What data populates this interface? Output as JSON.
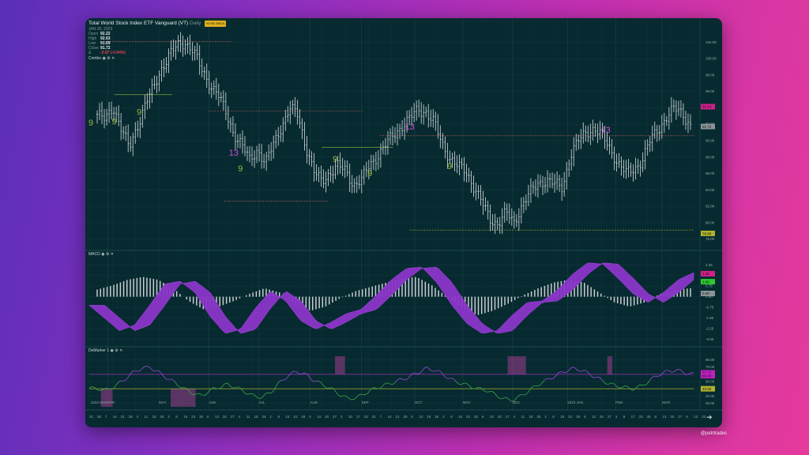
{
  "window": {
    "title": "Total World Stock Index ETF Vanguard (VT)",
    "interval": "Daily",
    "exchange_badge": "NYSE ARCA",
    "date": "JAN 30, 2023",
    "ohlc": [
      {
        "label": "Open",
        "value": "92.22"
      },
      {
        "label": "High",
        "value": "92.63"
      },
      {
        "label": "Low",
        "value": "91.69"
      },
      {
        "label": "Close",
        "value": "91.72"
      },
      {
        "label": "Δ",
        "value": "-0.87 (-0.94%)"
      }
    ],
    "indicator_tag": "Combo",
    "credit": "@petrtrades"
  },
  "price_axis": {
    "ticks": [
      "102.00",
      "100.00",
      "98.00",
      "96.00",
      "94.00",
      "92.00",
      "90.00",
      "88.00",
      "86.00",
      "84.00",
      "82.00",
      "80.00",
      "78.00"
    ],
    "badges": [
      {
        "text": "94.14",
        "color": "#d0208a"
      },
      {
        "text": "91.72",
        "color": "#8a9395"
      },
      {
        "text": "78.68",
        "color": "#b0b030"
      }
    ]
  },
  "macd_panel": {
    "label": "MACD",
    "ticks": [
      "2.25",
      "1.50",
      "0.75",
      "0.00",
      "-0.75",
      "-1.50",
      "-2.25",
      "-3.00"
    ],
    "badges": [
      {
        "text": "1.46",
        "color": "#d0208a"
      },
      {
        "text": "1.06",
        "color": "#2ec82e"
      },
      {
        "text": "0.40",
        "color": "#8a9395"
      }
    ]
  },
  "demarker_panel": {
    "label": "DeMarker 1",
    "ticks": [
      "80.00",
      "70.00",
      "60.00",
      "50.00",
      "40.00",
      "30.00",
      "20.00"
    ],
    "badges": [
      {
        "text": "60.32",
        "color": "#c020c0"
      },
      {
        "text": "60.00",
        "color": "#c020c0"
      },
      {
        "text": "40.00",
        "color": "#b0b030"
      }
    ]
  },
  "x_axis": {
    "months": [
      "2022 MAR",
      "APR",
      "MAY",
      "JUN",
      "JUL",
      "AUG",
      "SEP",
      "OCT",
      "NOV",
      "DEC",
      "2023 JAN",
      "FEB",
      "MAR"
    ],
    "days": [
      "21",
      "28",
      "7",
      "14",
      "21",
      "28",
      "4",
      "11",
      "19",
      "25",
      "2",
      "9",
      "16",
      "23",
      "30",
      "6",
      "13",
      "20",
      "27",
      "4",
      "11",
      "18",
      "25",
      "1",
      "8",
      "15",
      "22",
      "29",
      "6",
      "13",
      "20",
      "27",
      "3",
      "10",
      "17",
      "24",
      "31",
      "7",
      "14",
      "21",
      "28",
      "5",
      "12",
      "19",
      "26",
      "2",
      "9",
      "16",
      "23",
      "30",
      "6",
      "13",
      "20",
      "27",
      "4",
      "11",
      "18",
      "25",
      "1",
      "8",
      "15",
      "22",
      "29",
      "6",
      "13",
      "20",
      "27",
      "3",
      "9",
      "17",
      "23",
      "30",
      "6",
      "13",
      "20",
      "27",
      "6",
      "13",
      "20"
    ]
  },
  "chart_data": {
    "type": "candlestick",
    "series_name": "VT daily",
    "ylim": [
      77,
      103
    ],
    "x_start": "2022-03-21",
    "x_end": "2023-03-20",
    "closes": [
      93.2,
      92.5,
      94.2,
      91.5,
      89.0,
      91.8,
      94.5,
      96.3,
      98.8,
      100.5,
      101.5,
      102.0,
      101.0,
      98.6,
      97.0,
      95.8,
      93.5,
      91.0,
      89.5,
      87.6,
      88.9,
      87.2,
      89.6,
      91.8,
      93.9,
      93.2,
      89.4,
      86.2,
      85.0,
      86.1,
      86.9,
      86.3,
      84.6,
      85.2,
      87.0,
      88.2,
      89.5,
      90.7,
      91.8,
      92.7,
      93.8,
      93.5,
      92.2,
      89.6,
      87.9,
      86.8,
      86.2,
      84.4,
      82.4,
      80.4,
      79.9,
      81.2,
      80.0,
      82.2,
      83.6,
      84.8,
      85.2,
      84.7,
      84.3,
      88.2,
      89.9,
      91.1,
      91.5,
      90.5,
      89.0,
      87.2,
      86.0,
      86.6,
      87.6,
      90.0,
      91.5,
      92.8,
      93.9,
      93.5,
      91.7
    ],
    "td_counts": [
      {
        "label": "9",
        "date": "2022-03-22",
        "color": "#9ab83a"
      },
      {
        "label": "9",
        "date": "2022-04-05",
        "color": "#9ab83a"
      },
      {
        "label": "9",
        "date": "2022-04-20",
        "color": "#9ab83a"
      },
      {
        "label": "13",
        "date": "2022-06-16",
        "color": "#d050d0"
      },
      {
        "label": "9",
        "date": "2022-06-20",
        "color": "#9ab83a"
      },
      {
        "label": "9",
        "date": "2022-08-16",
        "color": "#9ab83a"
      },
      {
        "label": "9",
        "date": "2022-09-06",
        "color": "#9ab83a"
      },
      {
        "label": "13",
        "date": "2022-09-30",
        "color": "#d050d0"
      },
      {
        "label": "9",
        "date": "2022-10-24",
        "color": "#9ab83a"
      },
      {
        "label": "13",
        "date": "2023-01-26",
        "color": "#d050d0"
      }
    ],
    "macd": {
      "hist_closes": [
        0.5,
        0.8,
        1.2,
        1.4,
        1.2,
        0.6,
        -0.3,
        -0.9,
        -0.7,
        -0.3,
        0.2,
        0.6,
        0.3,
        -0.4,
        -1.0,
        -0.7,
        -0.1,
        0.4,
        0.7,
        1.0,
        1.3,
        1.4,
        0.8,
        0.0,
        -0.8,
        -1.3,
        -1.0,
        -0.5,
        0.1,
        0.6,
        1.0,
        1.2,
        1.0,
        0.3,
        -0.4,
        -0.7,
        -0.4,
        0.2,
        0.5,
        0.6
      ],
      "line_closes": [
        -0.6,
        -1.5,
        -2.4,
        -2.0,
        -0.6,
        0.9,
        1.1,
        0.3,
        -1.4,
        -2.6,
        -2.3,
        -0.8,
        0.4,
        -0.3,
        -1.7,
        -2.3,
        -1.8,
        -1.2,
        -0.9,
        0.1,
        1.2,
        2.0,
        2.1,
        1.0,
        -0.6,
        -1.9,
        -2.6,
        -2.4,
        -1.3,
        -0.4,
        -0.3,
        0.5,
        1.6,
        2.4,
        2.3,
        1.3,
        0.2,
        -0.4,
        0.3,
        1.2,
        1.7
      ]
    },
    "demarker": {
      "upper_level": 60,
      "lower_level": 40,
      "values": [
        41,
        40,
        38,
        44,
        52,
        62,
        68,
        70,
        63,
        55,
        48,
        40,
        34,
        30,
        38,
        42,
        46,
        42,
        36,
        30,
        28,
        35,
        48,
        58,
        64,
        60,
        52,
        46,
        40,
        32,
        26,
        28,
        34,
        40,
        44,
        48,
        52,
        56,
        62,
        68,
        66,
        60,
        52,
        48,
        44,
        40,
        38,
        32,
        26,
        24,
        30,
        38,
        46,
        52,
        58,
        64,
        68,
        66,
        60,
        54,
        48,
        44,
        42,
        40,
        44,
        52,
        60,
        64,
        66,
        62,
        60
      ]
    }
  }
}
